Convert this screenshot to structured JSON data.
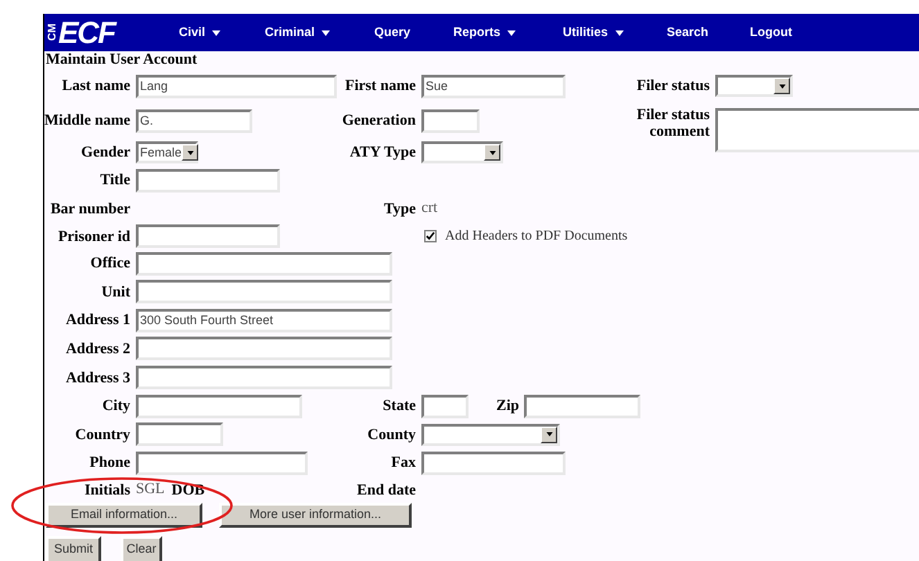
{
  "nav": {
    "logo_small": "CM",
    "logo": "ECF",
    "items": [
      {
        "label": "Civil",
        "has_menu": true
      },
      {
        "label": "Criminal",
        "has_menu": true
      },
      {
        "label": "Query",
        "has_menu": false
      },
      {
        "label": "Reports",
        "has_menu": true
      },
      {
        "label": "Utilities",
        "has_menu": true
      },
      {
        "label": "Search",
        "has_menu": false
      },
      {
        "label": "Logout",
        "has_menu": false
      }
    ]
  },
  "form_title": "Maintain User Account",
  "rows": [
    {
      "left": [
        {
          "kind": "input",
          "label": "Last name",
          "value": "Lang"
        }
      ],
      "middle": [
        {
          "kind": "input",
          "label": "First name",
          "value": "Sue"
        }
      ],
      "right": [
        {
          "kind": "select",
          "label": "Filer status"
        }
      ]
    },
    {
      "left": [
        {
          "kind": "input",
          "label": "Middle name",
          "value": "G."
        }
      ],
      "middle": [
        {
          "kind": "input",
          "label": "Generation"
        }
      ],
      "right": [
        {
          "kind": "textarea",
          "label": "Filer status comment"
        }
      ]
    },
    {
      "left": [
        {
          "kind": "select",
          "label": "Gender",
          "value": "Female"
        }
      ],
      "middle": [
        {
          "kind": "select",
          "label": "ATY Type"
        }
      ]
    },
    {
      "left": [
        {
          "kind": "input",
          "label": "Title"
        }
      ]
    },
    {
      "left": [
        {
          "kind": "text",
          "label": "Bar number"
        }
      ],
      "middle": [
        {
          "kind": "text",
          "label": "Type",
          "value": "crt"
        }
      ]
    },
    {
      "left": [
        {
          "kind": "input",
          "label": "Prisoner id"
        }
      ],
      "middle": [
        {
          "kind": "checkbox",
          "label": "Add Headers to PDF Documents",
          "checked": true
        }
      ]
    },
    {
      "left": [
        {
          "kind": "input",
          "label": "Office"
        }
      ]
    },
    {
      "left": [
        {
          "kind": "input",
          "label": "Unit"
        }
      ]
    },
    {
      "left": [
        {
          "kind": "input",
          "label": "Address 1",
          "value": "300 South Fourth Street"
        }
      ]
    },
    {
      "left": [
        {
          "kind": "input",
          "label": "Address 2"
        }
      ]
    },
    {
      "left": [
        {
          "kind": "input",
          "label": "Address 3"
        }
      ]
    },
    {
      "left": [
        {
          "kind": "input",
          "label": "City"
        }
      ],
      "middle": [
        {
          "kind": "input",
          "label": "State"
        },
        {
          "kind": "input",
          "label": "Zip"
        }
      ]
    },
    {
      "left": [
        {
          "kind": "input",
          "label": "Country"
        }
      ],
      "middle": [
        {
          "kind": "select",
          "label": "County"
        }
      ]
    },
    {
      "left": [
        {
          "kind": "input",
          "label": "Phone"
        }
      ],
      "middle": [
        {
          "kind": "input",
          "label": "Fax"
        }
      ]
    },
    {
      "left": [
        {
          "kind": "text",
          "label": "Initials",
          "value": "SGL"
        },
        {
          "kind": "text",
          "label": "DOB"
        }
      ],
      "middle": [
        {
          "kind": "text",
          "label": "End date"
        }
      ]
    }
  ],
  "info_buttons": [
    "Email information...",
    "More user information..."
  ],
  "action_buttons": [
    "Submit",
    "Clear"
  ]
}
